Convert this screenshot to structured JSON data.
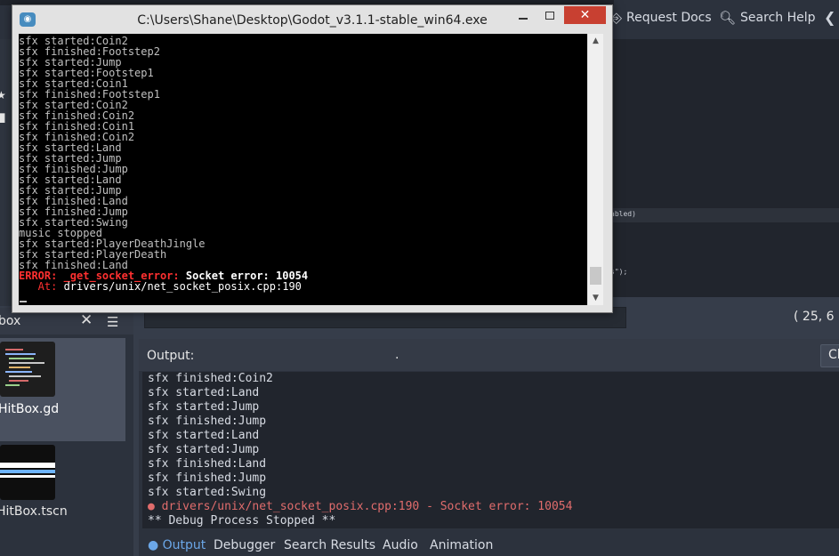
{
  "top_bar": {
    "request_docs_label": "Request Docs",
    "search_help_label": "Search Help",
    "collapse_glyph": "❮"
  },
  "script_editor": {
    "fragment_1": "abled)",
    "fragment_2": "s\");"
  },
  "left_toolbar": {
    "icons": [
      "star-icon",
      "folder-icon"
    ]
  },
  "filesystem_dock": {
    "title_fragment": "box",
    "close_glyph": "✕",
    "list_view_glyph": "☰",
    "items": [
      {
        "label": "HitBox.gd",
        "selected": true,
        "icon": "script-thumbnail"
      },
      {
        "label": "HitBox.tscn",
        "selected": false,
        "icon": "scene-thumbnail"
      }
    ]
  },
  "status_bar": {
    "cursor_position": "( 25, 6"
  },
  "output_panel": {
    "title": "Output:",
    "center_glyph": ".",
    "clear_label": "Cl",
    "lines": [
      "sfx finished:Coin2",
      "sfx started:Land",
      "sfx started:Jump",
      "sfx finished:Jump",
      "sfx started:Land",
      "sfx started:Jump",
      "sfx finished:Land",
      "sfx finished:Jump",
      "sfx started:Swing"
    ],
    "error_line": "● drivers/unix/net_socket_posix.cpp:190 - Socket error: 10054",
    "stopped_line": "** Debug Process Stopped **",
    "error_color": "#e06c6c"
  },
  "bottom_tabs": {
    "items": [
      {
        "label": "● Output",
        "active": true
      },
      {
        "label": "Debugger",
        "active": false
      },
      {
        "label": "Search Results",
        "active": false
      },
      {
        "label": "Audio",
        "active": false
      },
      {
        "label": "Animation",
        "active": false
      }
    ],
    "active_color": "#6ba7e8"
  },
  "console_window": {
    "title": "C:\\Users\\Shane\\Desktop\\Godot_v3.1.1-stable_win64.exe",
    "app_icon_glyph": "◉",
    "close_glyph": "✕",
    "lines": [
      "sfx started:Coin2",
      "sfx finished:Footstep2",
      "sfx started:Jump",
      "sfx started:Footstep1",
      "sfx started:Coin1",
      "sfx finished:Footstep1",
      "sfx started:Coin2",
      "sfx finished:Coin2",
      "sfx finished:Coin1",
      "sfx finished:Coin2",
      "sfx started:Land",
      "sfx started:Jump",
      "sfx finished:Jump",
      "sfx started:Land",
      "sfx started:Jump",
      "sfx finished:Land",
      "sfx finished:Jump",
      "sfx started:Swing",
      "music stopped",
      "sfx started:PlayerDeathJingle",
      "sfx started:PlayerDeath",
      "sfx finished:Land"
    ],
    "error_tag": "ERROR: _get_socket_error:",
    "error_message": " Socket error: 10054",
    "at_tag": "   At:",
    "at_message": " drivers/unix/net_socket_posix.cpp:190",
    "scroll_up_glyph": "▲",
    "scroll_down_glyph": "▼",
    "error_color": "#ff3030",
    "title_close_color": "#c84031"
  }
}
